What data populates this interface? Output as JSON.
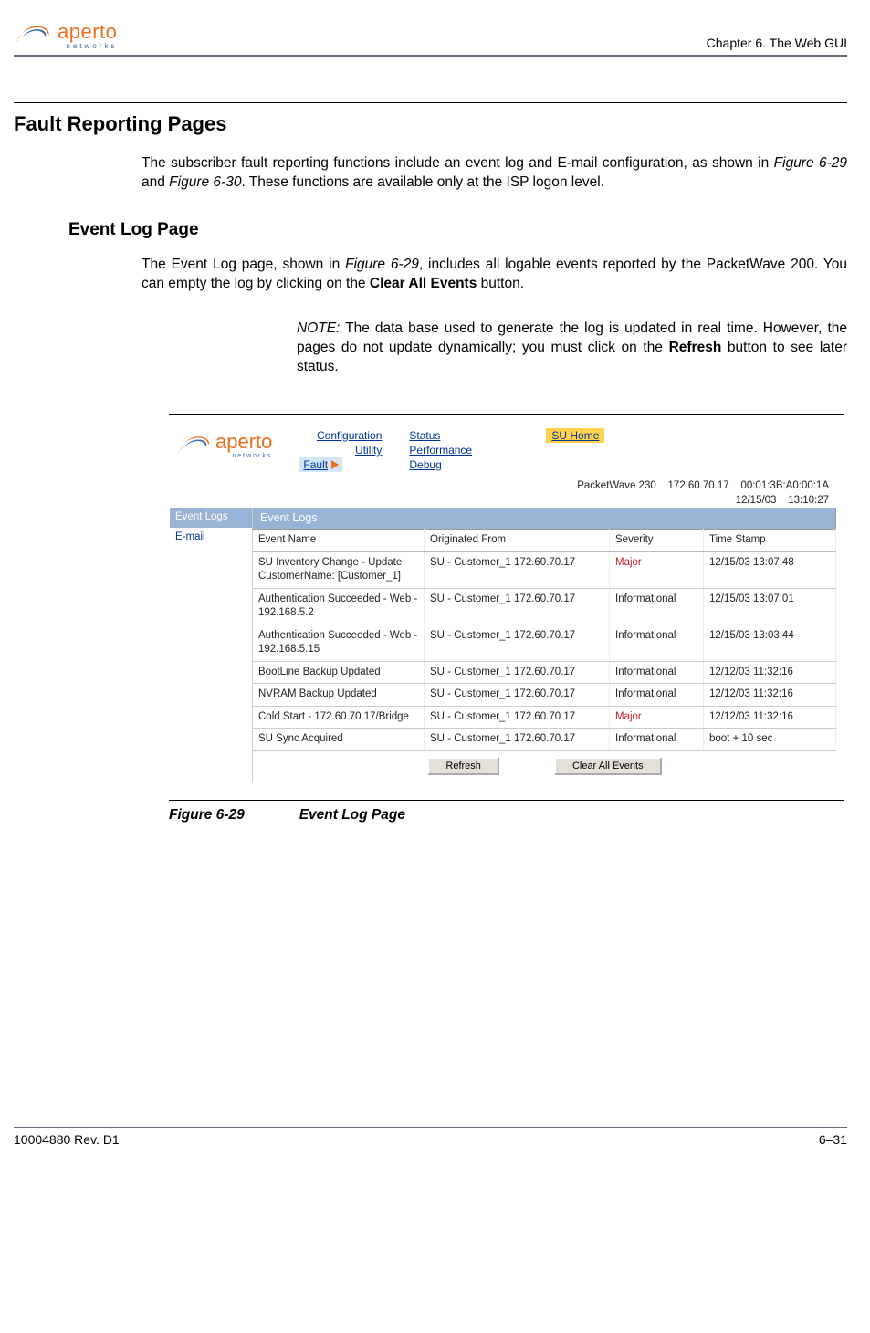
{
  "header": {
    "logo_text": "aperto",
    "logo_sub": "networks",
    "chapter_ref": "Chapter 6.  The Web GUI"
  },
  "section": {
    "title": "Fault Reporting Pages",
    "intro_a": "The subscriber fault reporting functions include an event log and E-mail configuration, as shown in ",
    "intro_ref1": "Figure 6-29",
    "intro_mid": " and ",
    "intro_ref2": "Figure 6-30",
    "intro_b": ". These functions are available only at the ISP logon level."
  },
  "sub": {
    "title": "Event Log Page",
    "p1_a": "The Event Log page, shown in ",
    "p1_ref": "Figure 6-29",
    "p1_b": ", includes all logable events reported by the PacketWave 200. You can empty the log by clicking on the ",
    "p1_bold": "Clear All Events",
    "p1_c": " button.",
    "note_lead": "NOTE:",
    "note_a": "  The data base used to generate the log is updated in real time. However, the pages do not update dynamically; you must click on the ",
    "note_bold": "Refresh",
    "note_b": " button to see later status."
  },
  "shot": {
    "logo_text": "aperto",
    "logo_sub": "networks",
    "nav1": {
      "a": "Configuration",
      "b": "Utility",
      "c": "Fault"
    },
    "nav2": {
      "a": "Status",
      "b": "Performance",
      "c": "Debug"
    },
    "su_home": "SU Home",
    "status_line1": "PacketWave 230    172.60.70.17    00:01:3B:A0:00:1A",
    "status_line2": "12/15/03    13:10:27",
    "side": {
      "a": "Event Logs",
      "b": "E-mail"
    },
    "panel_title": "Event Logs",
    "cols": {
      "name": "Event Name",
      "from": "Originated From",
      "sev": "Severity",
      "ts": "Time Stamp"
    },
    "rows": [
      {
        "name": "SU Inventory Change - Update CustomerName: [Customer_1]",
        "from": "SU - Customer_1  172.60.70.17",
        "sev": "Major",
        "sevcls": "major",
        "ts": "12/15/03 13:07:48"
      },
      {
        "name": "Authentication Succeeded - Web - 192.168.5.2",
        "from": "SU - Customer_1  172.60.70.17",
        "sev": "Informational",
        "sevcls": "",
        "ts": "12/15/03 13:07:01"
      },
      {
        "name": "Authentication Succeeded - Web - 192.168.5.15",
        "from": "SU - Customer_1  172.60.70.17",
        "sev": "Informational",
        "sevcls": "",
        "ts": "12/15/03 13:03:44"
      },
      {
        "name": "BootLine Backup Updated",
        "from": "SU - Customer_1  172.60.70.17",
        "sev": "Informational",
        "sevcls": "",
        "ts": "12/12/03 11:32:16"
      },
      {
        "name": "NVRAM Backup Updated",
        "from": "SU - Customer_1  172.60.70.17",
        "sev": "Informational",
        "sevcls": "",
        "ts": "12/12/03 11:32:16"
      },
      {
        "name": "Cold Start - 172.60.70.17/Bridge",
        "from": "SU - Customer_1  172.60.70.17",
        "sev": "Major",
        "sevcls": "major",
        "ts": "12/12/03 11:32:16"
      },
      {
        "name": "SU Sync Acquired",
        "from": "SU - Customer_1  172.60.70.17",
        "sev": "Informational",
        "sevcls": "",
        "ts": "boot + 10 sec"
      }
    ],
    "btn_refresh": "Refresh",
    "btn_clear": "Clear All Events"
  },
  "caption": {
    "num": "Figure 6-29",
    "txt": "Event Log Page"
  },
  "footer": {
    "left": "10004880 Rev. D1",
    "right": "6–31"
  }
}
